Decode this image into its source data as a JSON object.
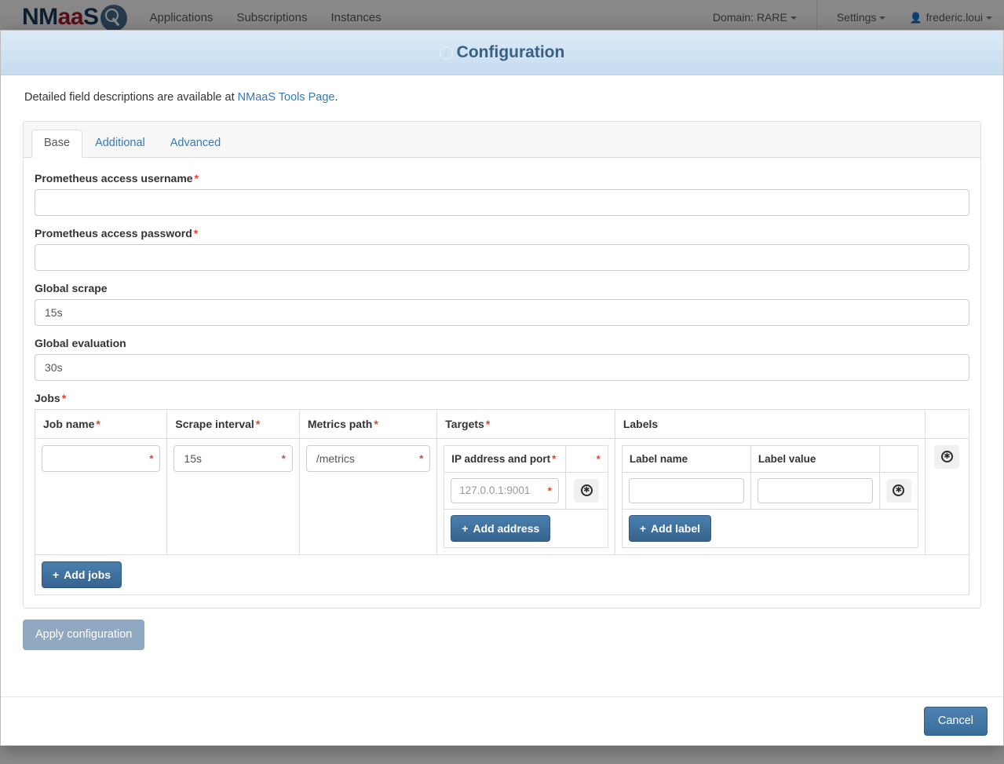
{
  "navbar": {
    "brand_prefix": "NM",
    "brand_mid": "aa",
    "brand_suffix": "S",
    "links": [
      {
        "label": "Applications"
      },
      {
        "label": "Subscriptions"
      },
      {
        "label": "Instances"
      }
    ],
    "domain_label": "Domain: RARE",
    "settings_label": "Settings",
    "user_label": "frederic.loui"
  },
  "modal": {
    "title": "Configuration",
    "info_icon": "info-icon",
    "intro_prefix": "Detailed field descriptions are available at ",
    "intro_link": "NMaaS Tools Page",
    "intro_suffix": ".",
    "tabs": [
      {
        "label": "Base",
        "active": true
      },
      {
        "label": "Additional",
        "active": false
      },
      {
        "label": "Advanced",
        "active": false
      }
    ],
    "fields": [
      {
        "label": "Prometheus access username",
        "required": true,
        "value": "",
        "placeholder": ""
      },
      {
        "label": "Prometheus access password",
        "required": true,
        "value": "",
        "placeholder": ""
      },
      {
        "label": "Global scrape",
        "required": false,
        "value": "15s",
        "placeholder": ""
      },
      {
        "label": "Global evaluation",
        "required": false,
        "value": "30s",
        "placeholder": ""
      }
    ],
    "jobs": {
      "label": "Jobs",
      "required_mark": "*",
      "columns": [
        {
          "label": "Job name",
          "required": true
        },
        {
          "label": "Scrape interval",
          "required": true
        },
        {
          "label": "Metrics path",
          "required": true
        },
        {
          "label": "Targets",
          "required": true
        },
        {
          "label": "Labels",
          "required": false
        },
        {
          "label": "",
          "required": false
        }
      ],
      "row": {
        "job_name": "",
        "job_name_star": "*",
        "scrape_interval": "15s",
        "scrape_interval_star": "*",
        "metrics_path": "/metrics",
        "metrics_path_star": "*",
        "targets": {
          "header": "IP address and port",
          "header_star": "*",
          "action_header_star": "*",
          "address_placeholder": "127.0.0.1:9001",
          "address_value": "",
          "address_star": "*",
          "add_button": "Add address",
          "remove_icon": "remove-circle-icon"
        },
        "labels": {
          "name_header": "Label name",
          "value_header": "Label value",
          "name_value": "",
          "value_value": "",
          "add_button": "Add label",
          "remove_icon": "remove-circle-icon"
        },
        "remove_icon": "remove-circle-icon"
      },
      "add_jobs_button": "Add jobs",
      "plus_glyph": "+"
    },
    "apply_button": "Apply configuration",
    "cancel_button": "Cancel"
  },
  "colors": {
    "header_gradient_top": "#dceaf6",
    "header_gradient_bottom": "#c5dcef",
    "title_color": "#3a5f83",
    "link_color": "#337ab7",
    "required_red": "#e8402a",
    "primary_button": "#36648f",
    "muted_button": "#8fa9c2"
  }
}
